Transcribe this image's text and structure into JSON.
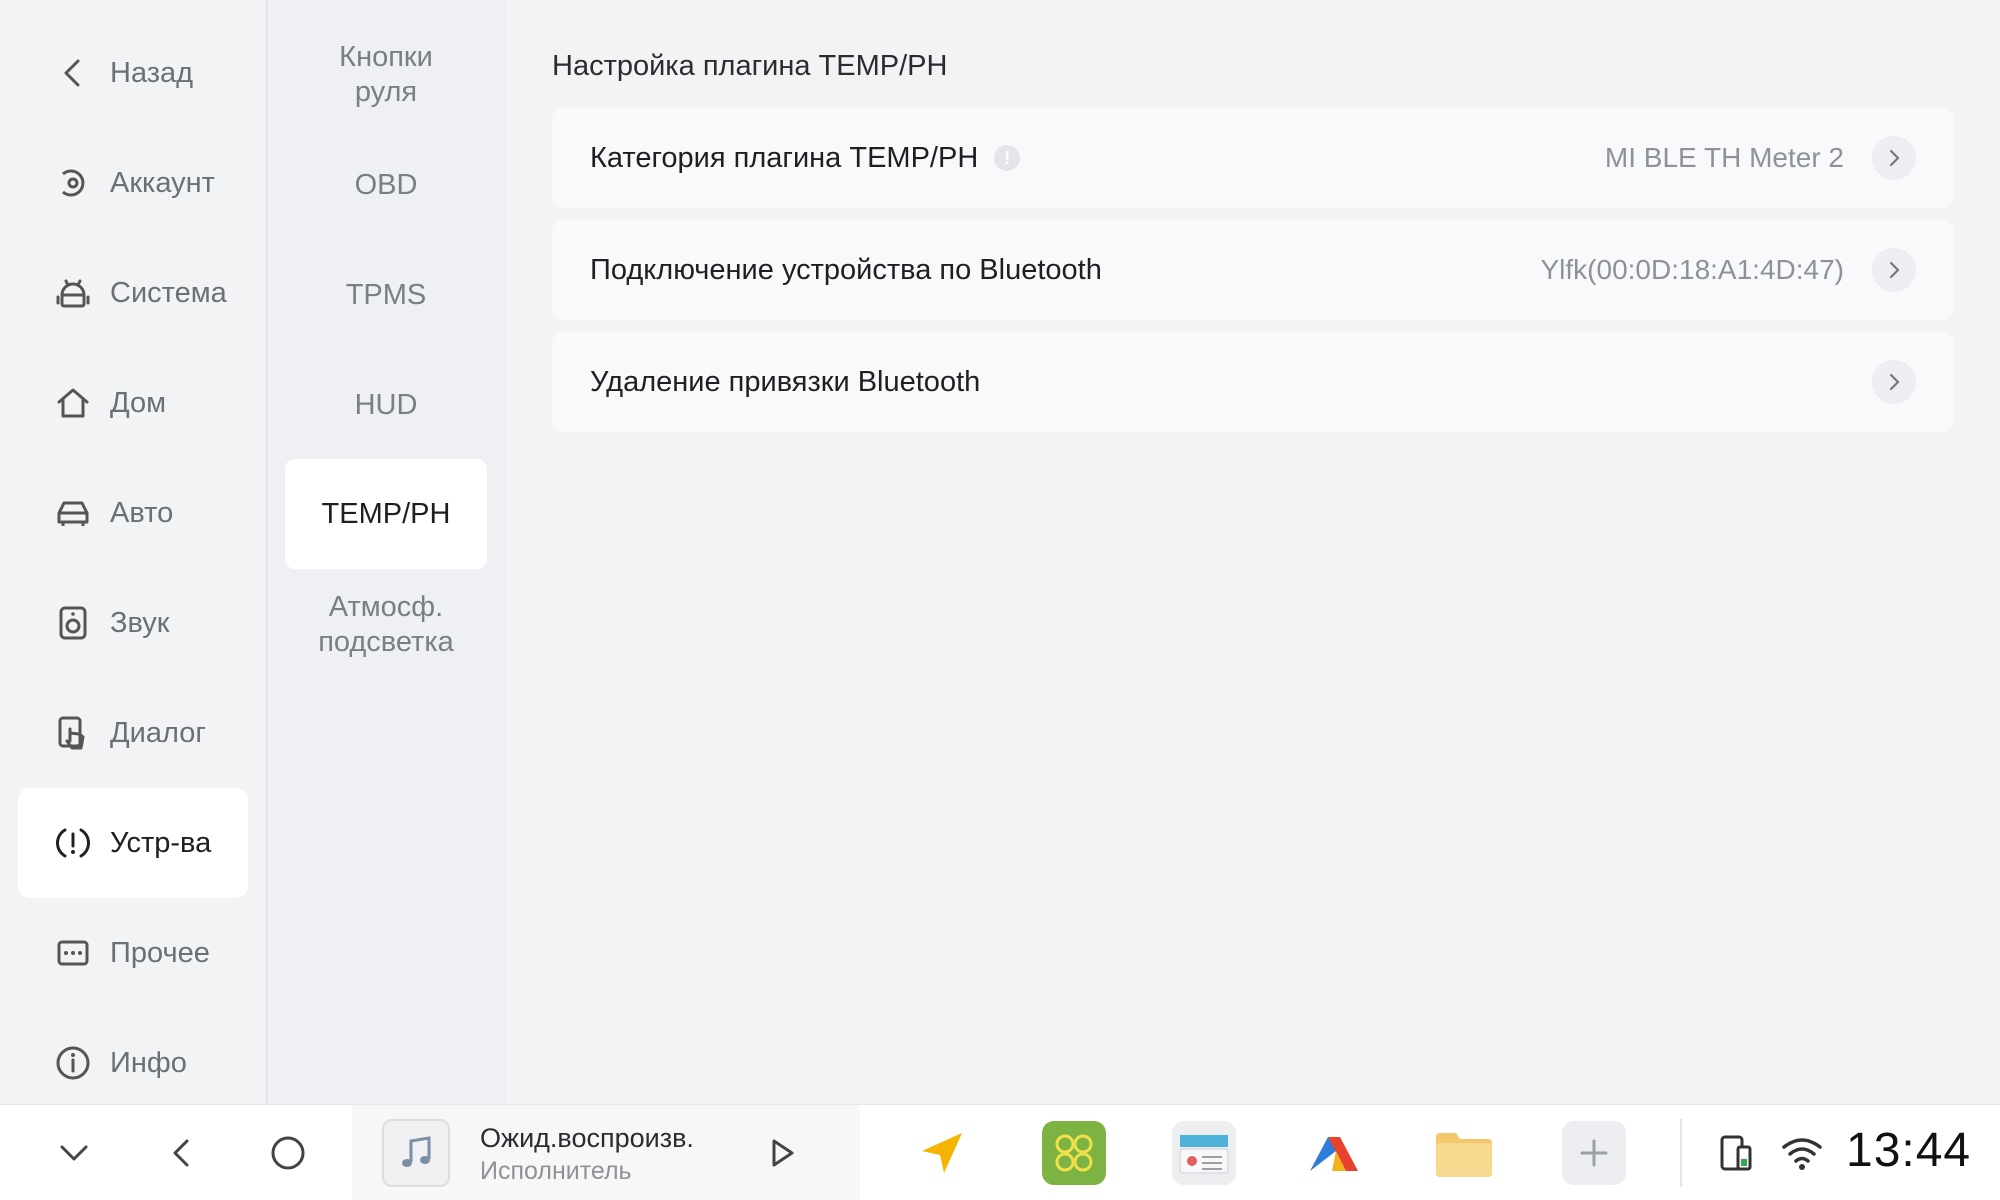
{
  "sidebar": {
    "items": [
      {
        "label": "Назад",
        "icon": "back-chevron-icon"
      },
      {
        "label": "Аккаунт",
        "icon": "account-icon"
      },
      {
        "label": "Система",
        "icon": "android-icon"
      },
      {
        "label": "Дом",
        "icon": "home-icon"
      },
      {
        "label": "Авто",
        "icon": "car-icon"
      },
      {
        "label": "Звук",
        "icon": "speaker-icon"
      },
      {
        "label": "Диалог",
        "icon": "touch-icon"
      },
      {
        "label": "Устр-ва",
        "icon": "device-alert-icon",
        "active": true
      },
      {
        "label": "Прочее",
        "icon": "more-icon"
      },
      {
        "label": "Инфо",
        "icon": "info-icon"
      }
    ]
  },
  "subnav": {
    "items": [
      {
        "label": "Кнопки\nруля"
      },
      {
        "label": "OBD"
      },
      {
        "label": "TPMS"
      },
      {
        "label": "HUD"
      },
      {
        "label": "TEMP/PH",
        "active": true
      },
      {
        "label": "Атмосф.\nподсветка"
      }
    ]
  },
  "main": {
    "title": "Настройка плагина TEMP/PH",
    "rows": [
      {
        "label": "Категория плагина TEMP/PH",
        "value": "MI BLE TH Meter 2",
        "info_badge": "!"
      },
      {
        "label": "Подключение устройства по Bluetooth",
        "value": "Ylfk(00:0D:18:A1:4D:47)"
      },
      {
        "label": "Удаление привязки Bluetooth",
        "value": ""
      }
    ]
  },
  "dock": {
    "media": {
      "title": "Ожид.воспроизв.",
      "artist": "Исполнитель"
    },
    "apps": [
      "navigation-icon",
      "apps-grid-icon",
      "radio-icon",
      "launcher-icon",
      "files-icon",
      "add-icon"
    ],
    "clock": "13:44"
  },
  "colors": {
    "background": "#f2f3f5",
    "card": "#f8f9fa",
    "active_item": "#ffffff",
    "apps_green": "#7cb342",
    "files_orange": "#f5c76b"
  }
}
